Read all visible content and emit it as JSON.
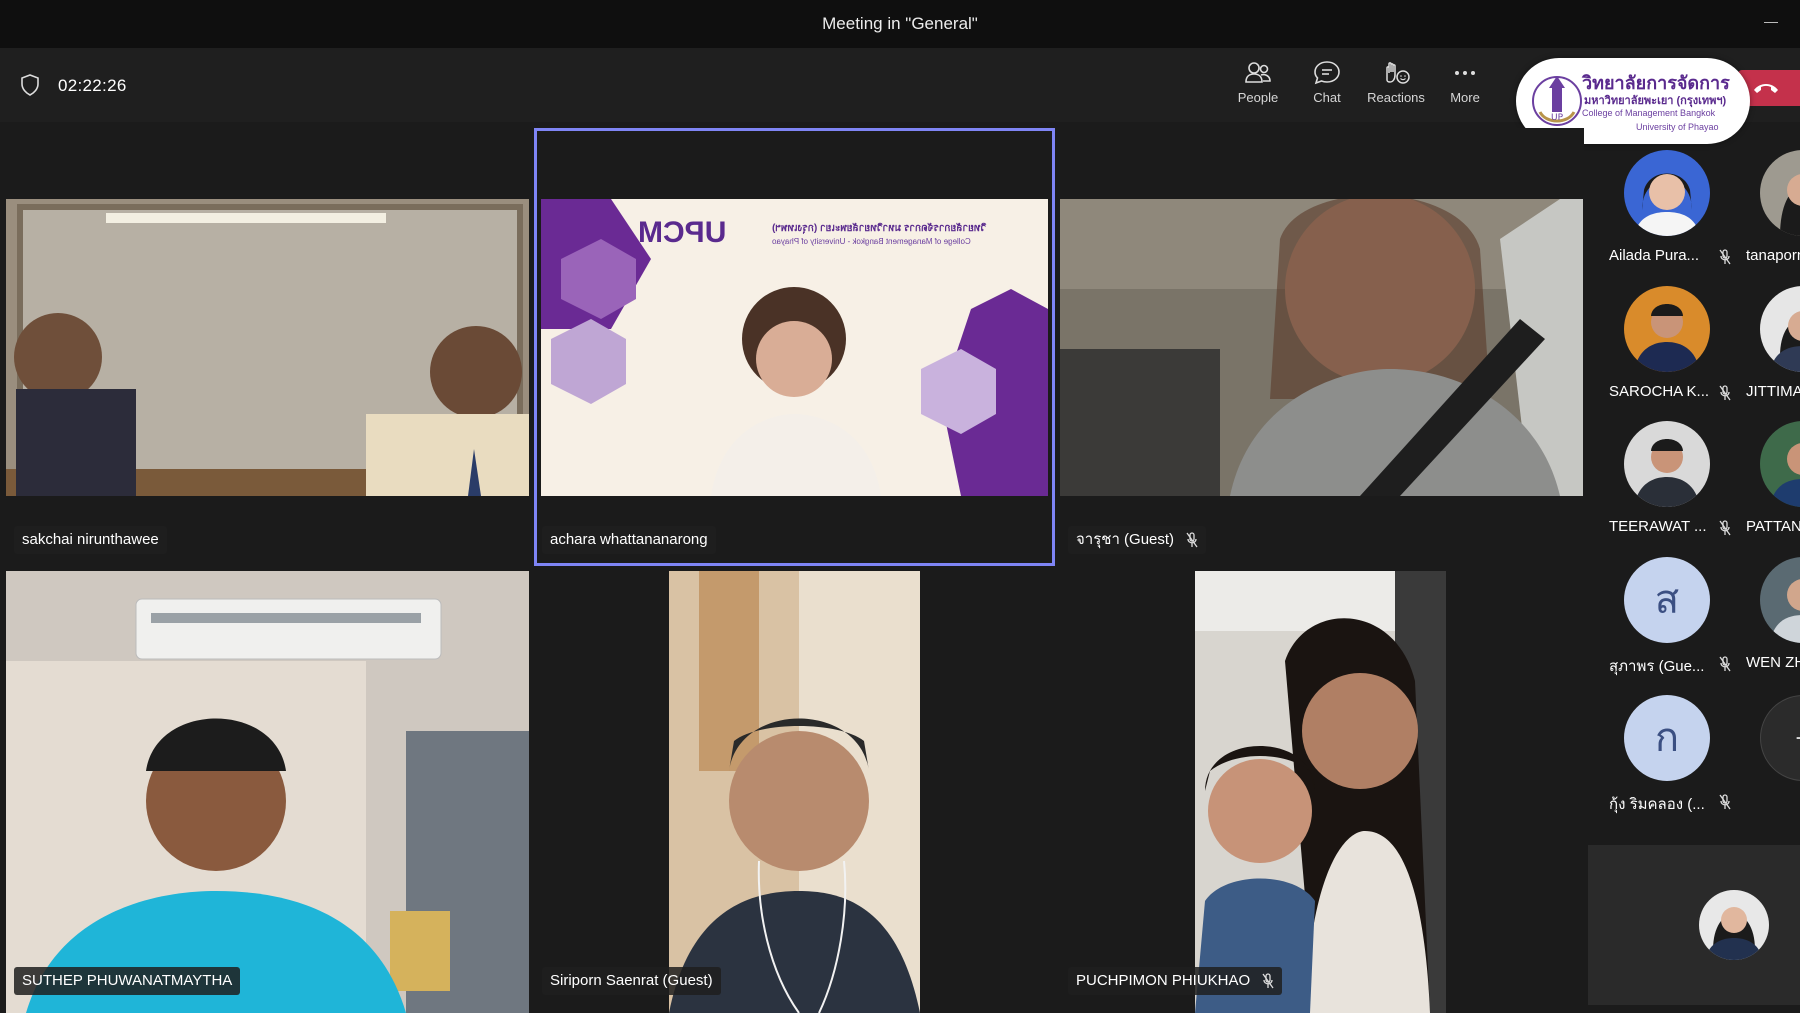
{
  "window": {
    "title": "Meeting in \"General\""
  },
  "header": {
    "timer": "02:22:26",
    "tools": [
      {
        "label": "People",
        "icon": "people-icon"
      },
      {
        "label": "Chat",
        "icon": "chat-icon"
      },
      {
        "label": "Reactions",
        "icon": "reactions-icon"
      },
      {
        "label": "More",
        "icon": "more-icon"
      }
    ],
    "hangup_icon": "phone-hangup-icon"
  },
  "logo": {
    "line1": "วิทยาลัยการจัดการ",
    "line2": "มหาวิทยาลัยพะเยา (กรุงเทพฯ)",
    "line3": "College of Management Bangkok",
    "line4": "University of Phayao"
  },
  "slide": {
    "brand": "UPCM",
    "heading": "วิทยาลัยการจัดการ มหาวิทยาลัยพะเยา (กรุงเทพฯ)",
    "subheading": "College of Management Bangkok - University of Phayao"
  },
  "tiles": [
    {
      "name": "sakchai nirunthawee",
      "muted": false,
      "active": false
    },
    {
      "name": "achara whattananarong",
      "muted": false,
      "active": true
    },
    {
      "name": "จารุชา (Guest)",
      "muted": true,
      "active": false
    },
    {
      "name": "SUTHEP PHUWANATMAYTHA",
      "muted": false,
      "active": false
    },
    {
      "name": "Siriporn Saenrat (Guest)",
      "muted": false,
      "active": false
    },
    {
      "name": "PUCHPIMON PHIUKHAO",
      "muted": true,
      "active": false
    }
  ],
  "roster": [
    {
      "name": "Ailada Pura...",
      "avatar": "photo",
      "muted": true
    },
    {
      "name": "tanaporn",
      "avatar": "photo",
      "muted": false
    },
    {
      "name": "SAROCHA K...",
      "avatar": "photo",
      "muted": true
    },
    {
      "name": "JITTIMA",
      "avatar": "photo",
      "muted": false
    },
    {
      "name": "TEERAWAT ...",
      "avatar": "photo",
      "muted": true
    },
    {
      "name": "PATTANA",
      "avatar": "photo",
      "muted": false
    },
    {
      "name": "สุภาพร (Gue...",
      "avatar": "ส",
      "muted": true
    },
    {
      "name": "WEN ZH",
      "avatar": "photo",
      "muted": false
    },
    {
      "name": "กุ้ง ริมคลอง (...",
      "avatar": "ก",
      "muted": true
    },
    {
      "name": "",
      "avatar": "+",
      "muted": false
    }
  ],
  "colors": {
    "accent": "#7f85f5",
    "hangup": "#c4314b",
    "brand_purple": "#5a2a8e"
  }
}
